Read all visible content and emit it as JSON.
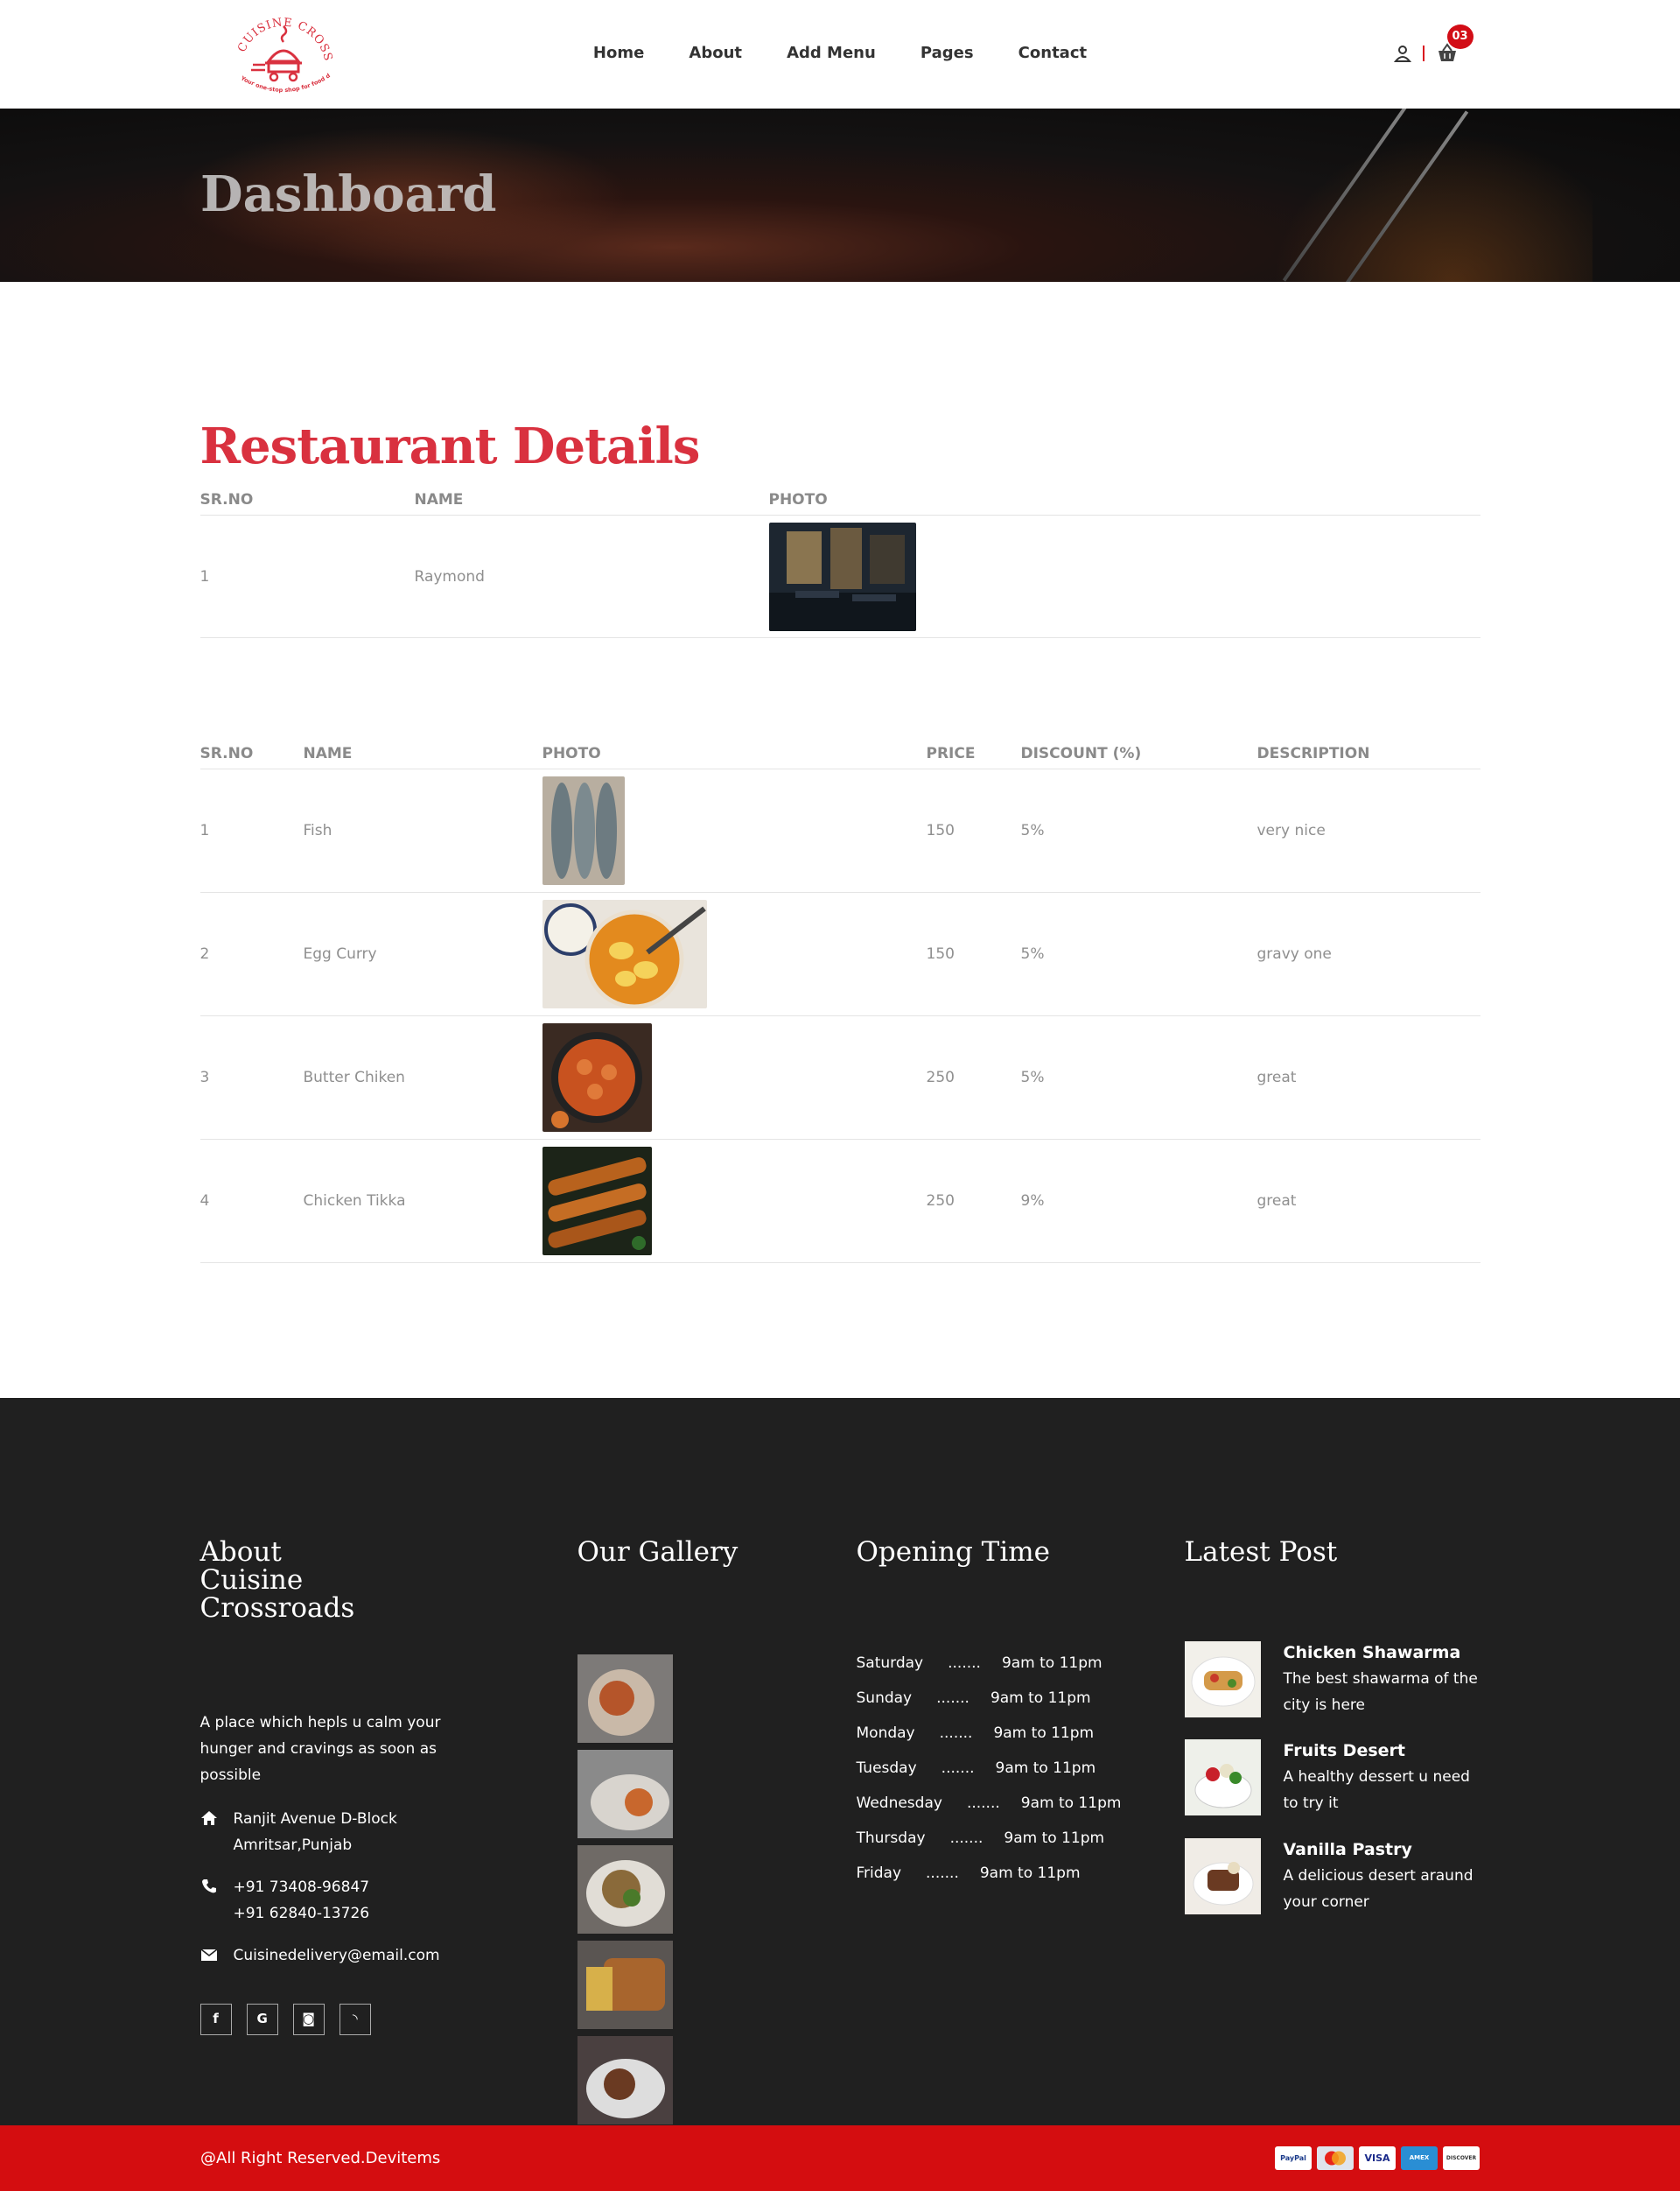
{
  "header": {
    "logo_text": "Cuisine Crossroads",
    "logo_tagline": "Your one-stop shop for food delivery",
    "nav": [
      "Home",
      "About",
      "Add Menu",
      "Pages",
      "Contact"
    ],
    "cart_count": "03"
  },
  "banner": {
    "title": "Dashboard"
  },
  "restaurant": {
    "title": "Restaurant Details",
    "columns": [
      "SR.NO",
      "NAME",
      "PHOTO"
    ],
    "rows": [
      {
        "sr": "1",
        "name": "Raymond",
        "photo": "restaurant-interior"
      }
    ]
  },
  "menu": {
    "columns": [
      "SR.NO",
      "NAME",
      "PHOTO",
      "PRICE",
      "DISCOUNT (%)",
      "DESCRIPTION"
    ],
    "rows": [
      {
        "sr": "1",
        "name": "Fish",
        "photo": "fish",
        "price": "150",
        "discount": "5%",
        "description": "very nice"
      },
      {
        "sr": "2",
        "name": "Egg Curry",
        "photo": "egg-curry",
        "price": "150",
        "discount": "5%",
        "description": "gravy one"
      },
      {
        "sr": "3",
        "name": "Butter Chiken",
        "photo": "butter-chicken",
        "price": "250",
        "discount": "5%",
        "description": "great"
      },
      {
        "sr": "4",
        "name": "Chicken Tikka",
        "photo": "chicken-tikka",
        "price": "250",
        "discount": "9%",
        "description": "great"
      }
    ]
  },
  "footer": {
    "about": {
      "title": "About Cuisine Crossroads",
      "text": "A place which hepls u calm your hunger and cravings as soon as possible",
      "address_line1": "Ranjit Avenue D-Block",
      "address_line2": "Amritsar,Punjab",
      "phone1": "+91 73408-96847",
      "phone2": "+91 62840-13726",
      "email": "Cuisinedelivery@email.com"
    },
    "gallery_title": "Our Gallery",
    "opening": {
      "title": "Opening Time",
      "rows": [
        {
          "day": "Saturday",
          "dots": ".......",
          "time": "9am to 11pm"
        },
        {
          "day": "Sunday",
          "dots": ".......",
          "time": "9am to 11pm"
        },
        {
          "day": "Monday",
          "dots": ".......",
          "time": "9am to 11pm"
        },
        {
          "day": "Tuesday",
          "dots": ".......",
          "time": "9am to 11pm"
        },
        {
          "day": "Wednesday",
          "dots": ".......",
          "time": "9am to 11pm"
        },
        {
          "day": "Thursday",
          "dots": ".......",
          "time": "9am to 11pm"
        },
        {
          "day": "Friday",
          "dots": ".......",
          "time": "9am to 11pm"
        }
      ]
    },
    "latest": {
      "title": "Latest Post",
      "posts": [
        {
          "title": "Chicken Shawarma",
          "desc": "The best shawarma of the city is here"
        },
        {
          "title": "Fruits Desert",
          "desc": "A healthy dessert u need to try it"
        },
        {
          "title": "Vanilla Pastry",
          "desc": "A delicious desert araund your corner"
        }
      ]
    },
    "copyright": "@All Right Reserved.Devitems",
    "payments": [
      "PayPal",
      "MasterCard",
      "VISA",
      "AMEX",
      "DISCOVER"
    ]
  },
  "colors": {
    "accent": "#d9313f",
    "footer_bg": "#202020",
    "bottom_bar": "#d40d10"
  }
}
